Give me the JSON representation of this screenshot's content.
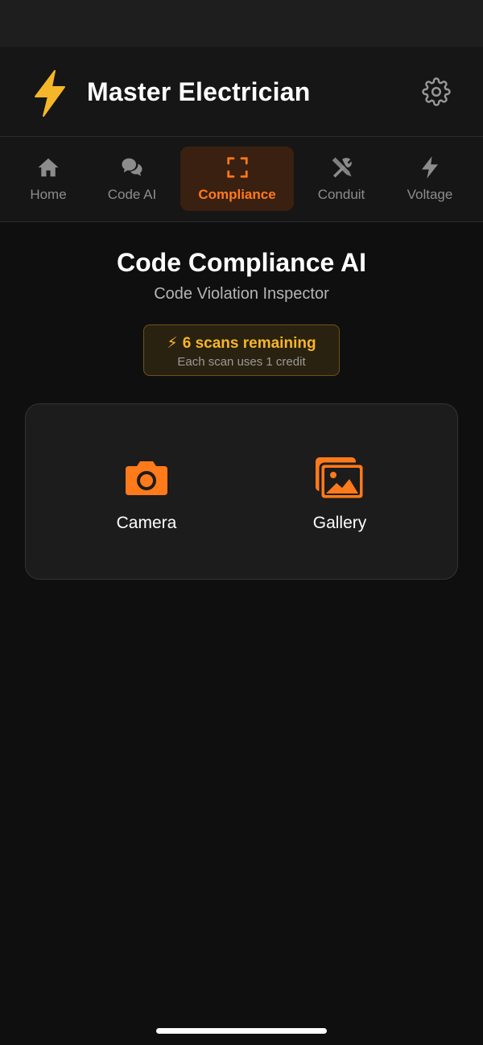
{
  "app": {
    "title": "Master Electrician"
  },
  "icons": {
    "logo": "lightning-bolt-icon",
    "settings": "gear-icon",
    "camera": "camera-icon",
    "gallery": "images-icon"
  },
  "colors": {
    "accent": "#ff7a1a",
    "logo": "#f6b62a",
    "background": "#0f0f0f"
  },
  "tabs": [
    {
      "label": "Home",
      "icon": "home-icon",
      "active": false
    },
    {
      "label": "Code AI",
      "icon": "chat-bubbles-icon",
      "active": false
    },
    {
      "label": "Compliance",
      "icon": "scan-frame-icon",
      "active": true
    },
    {
      "label": "Conduit",
      "icon": "tools-icon",
      "active": false
    },
    {
      "label": "Voltage",
      "icon": "bolt-icon",
      "active": false
    }
  ],
  "page": {
    "title": "Code Compliance AI",
    "subtitle": "Code Violation Inspector"
  },
  "credits": {
    "bolt": "⚡",
    "remaining_text": "6 scans remaining",
    "note": "Each scan uses 1 credit"
  },
  "sources": {
    "camera_label": "Camera",
    "gallery_label": "Gallery"
  }
}
